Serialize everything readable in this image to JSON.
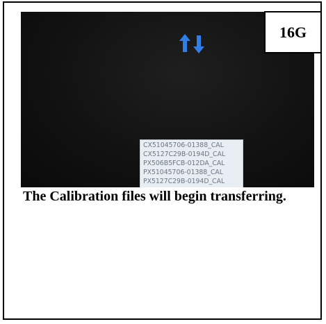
{
  "step": {
    "label": "16G"
  },
  "screen": {
    "icon": "sync-arrows-icon",
    "accent_color": "#2f7fe6",
    "background_color": "#111111",
    "files": [
      "CX51045706-01388_CAL",
      "CX5127C29B-0194D_CAL",
      "PX506B5FCB-012DA_CAL",
      "PX51045706-01388_CAL",
      "PX5127C29B-0194D_CAL"
    ]
  },
  "caption": {
    "text": "The Calibration files will begin transferring."
  }
}
